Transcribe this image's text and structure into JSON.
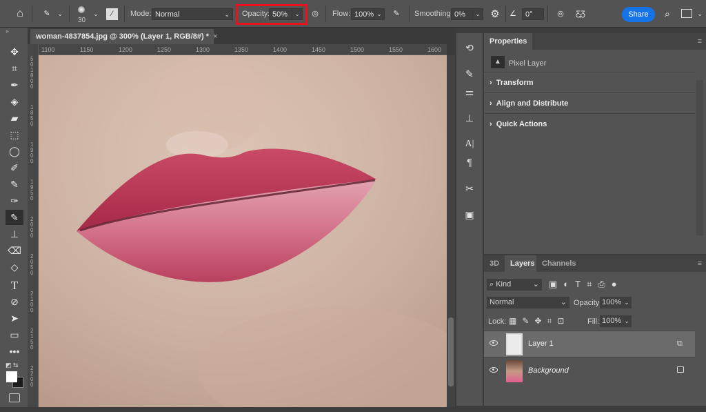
{
  "options_bar": {
    "brush_size": "30",
    "mode_label": "Mode:",
    "mode_value": "Normal",
    "opacity_label": "Opacity:",
    "opacity_value": "50%",
    "flow_label": "Flow:",
    "flow_value": "100%",
    "smoothing_label": "Smoothing:",
    "smoothing_value": "0%",
    "angle_value": "0°",
    "share_label": "Share",
    "highlight_color": "#e8141c"
  },
  "document": {
    "tab_title": "woman-4837854.jpg @ 300% (Layer 1, RGB/8#) *",
    "close": "×"
  },
  "ruler": {
    "top": [
      "1100",
      "1150",
      "1200",
      "1250",
      "1300",
      "1350",
      "1400",
      "1450",
      "1500",
      "1550",
      "1600"
    ],
    "left": [
      "50",
      "1800",
      "1850",
      "1900",
      "1950",
      "2000",
      "2050",
      "2100",
      "2150",
      "2200"
    ]
  },
  "properties": {
    "tab": "Properties",
    "layer_type": "Pixel Layer",
    "sections": [
      "Transform",
      "Align and Distribute",
      "Quick Actions"
    ]
  },
  "layers_panel": {
    "tabs": [
      "3D",
      "Layers",
      "Channels"
    ],
    "active_tab": "Layers",
    "filter": "Kind",
    "blend_mode": "Normal",
    "opacity_label": "Opacity:",
    "opacity_value": "100%",
    "lock_label": "Lock:",
    "fill_label": "Fill:",
    "fill_value": "100%",
    "layers": [
      {
        "name": "Layer 1",
        "selected": true
      },
      {
        "name": "Background",
        "locked": true
      }
    ]
  }
}
